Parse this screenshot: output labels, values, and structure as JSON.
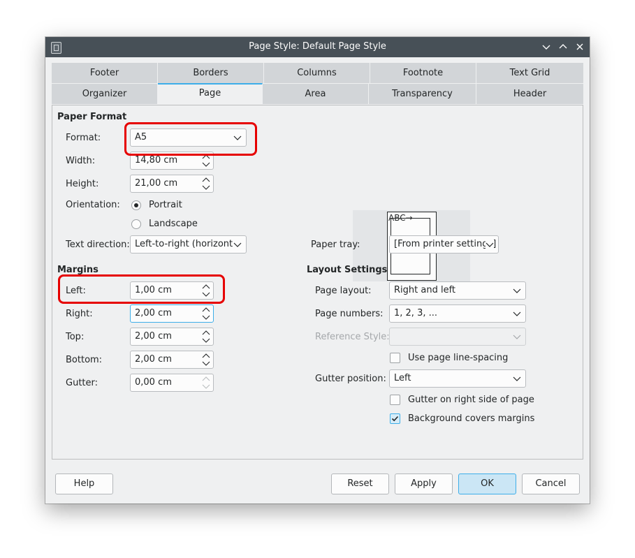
{
  "window": {
    "title": "Page Style: Default Page Style",
    "controls": [
      "chevron-down-icon",
      "chevron-up-icon",
      "close-icon"
    ]
  },
  "tabs": {
    "row1": [
      "Footer",
      "Borders",
      "Columns",
      "Footnote",
      "Text Grid"
    ],
    "row2": [
      "Organizer",
      "Page",
      "Area",
      "Transparency",
      "Header"
    ],
    "active": "Page"
  },
  "paper_format": {
    "heading": "Paper Format",
    "format_label": "Format:",
    "format_value": "A5",
    "width_label": "Width:",
    "width_value": "14,80 cm",
    "height_label": "Height:",
    "height_value": "21,00 cm",
    "orientation_label": "Orientation:",
    "portrait_label": "Portrait",
    "landscape_label": "Landscape",
    "orientation_selected": "Portrait",
    "text_direction_label": "Text direction:",
    "text_direction_value": "Left-to-right (horizontal",
    "paper_tray_label": "Paper tray:",
    "paper_tray_value": "[From printer settings]"
  },
  "preview": {
    "text": "ABC→"
  },
  "margins": {
    "heading": "Margins",
    "left_label": "Left:",
    "left_value": "1,00 cm",
    "right_label": "Right:",
    "right_value": "2,00 cm",
    "top_label": "Top:",
    "top_value": "2,00 cm",
    "bottom_label": "Bottom:",
    "bottom_value": "2,00 cm",
    "gutter_label": "Gutter:",
    "gutter_value": "0,00 cm"
  },
  "layout": {
    "heading": "Layout Settings",
    "page_layout_label": "Page layout:",
    "page_layout_value": "Right and left",
    "page_numbers_label": "Page numbers:",
    "page_numbers_value": "1, 2, 3, ...",
    "reference_style_label": "Reference Style:",
    "reference_style_value": "",
    "use_line_spacing_label": "Use page line-spacing",
    "use_line_spacing_checked": false,
    "gutter_position_label": "Gutter position:",
    "gutter_position_value": "Left",
    "gutter_right_label": "Gutter on right side of page",
    "gutter_right_checked": false,
    "bg_covers_label": "Background covers margins",
    "bg_covers_checked": true
  },
  "buttons": {
    "help": "Help",
    "reset": "Reset",
    "apply": "Apply",
    "ok": "OK",
    "cancel": "Cancel"
  },
  "colors": {
    "titlebar": "#475057",
    "accent": "#3daee9",
    "annotation_red": "#e60000"
  }
}
